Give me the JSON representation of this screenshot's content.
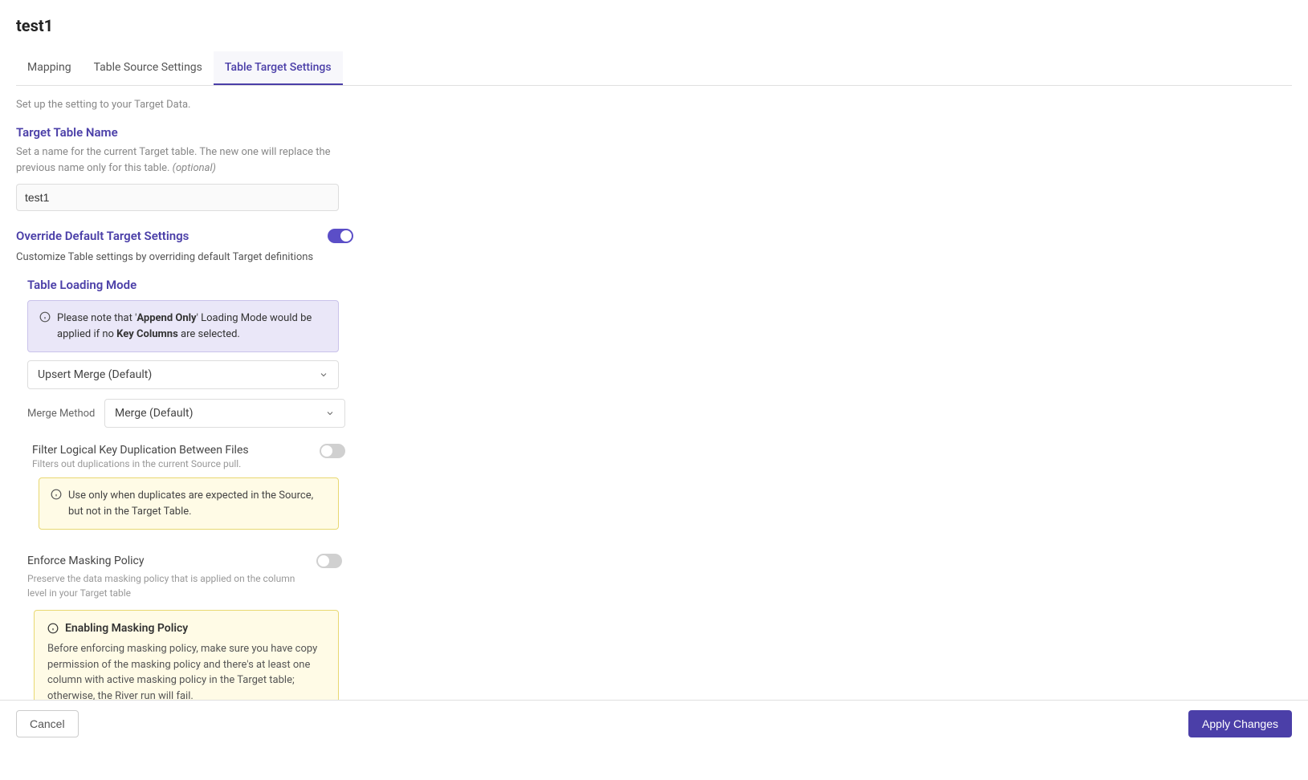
{
  "page_title": "test1",
  "tabs": [
    {
      "label": "Mapping"
    },
    {
      "label": "Table Source Settings"
    },
    {
      "label": "Table Target Settings"
    }
  ],
  "description": "Set up the setting to your Target Data.",
  "target_table": {
    "title": "Target Table Name",
    "sub": "Set a name for the current Target table. The new one will replace the previous name only for this table. ",
    "optional": "(optional)",
    "value": "test1"
  },
  "override": {
    "title": "Override Default Target Settings",
    "desc": "Customize Table settings by overriding default Target definitions"
  },
  "loading_mode": {
    "title": "Table Loading Mode",
    "note_pre": "Please note that '",
    "note_bold1": "Append Only",
    "note_mid": "' Loading Mode would be applied if no ",
    "note_bold2": "Key Columns",
    "note_post": " are selected.",
    "select_value": "Upsert Merge (Default)",
    "merge_label": "Merge Method",
    "merge_value": "Merge (Default)"
  },
  "filter": {
    "label": "Filter Logical Key Duplication Between Files",
    "sub": "Filters out duplications in the current Source pull.",
    "note": "Use only when duplicates are expected in the Source, but not in the Target Table."
  },
  "enforce": {
    "label": "Enforce Masking Policy",
    "sub": "Preserve the data masking policy that is applied on the column level in your Target table",
    "box_title": "Enabling Masking Policy",
    "box_body": "Before enforcing masking policy, make sure you have copy permission of the masking policy and there's at least one column with active masking policy in the Target table; otherwise, the River run will fail."
  },
  "footer": {
    "cancel": "Cancel",
    "apply": "Apply Changes"
  }
}
